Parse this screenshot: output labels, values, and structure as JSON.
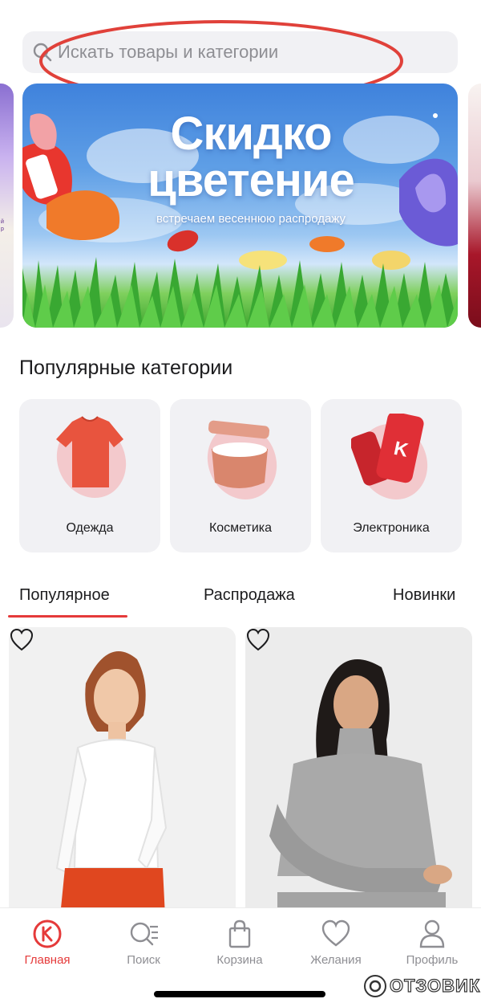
{
  "search": {
    "placeholder": "Искать товары и категории",
    "icon": "search-icon"
  },
  "banner": {
    "title_line1": "Скидко",
    "title_line2": "цветение",
    "subtitle": "встречаем весеннюю распродажу"
  },
  "popular_categories": {
    "title": "Популярные категории",
    "items": [
      {
        "label": "Одежда",
        "icon": "t-shirt-icon"
      },
      {
        "label": "Косметика",
        "icon": "cream-jar-icon"
      },
      {
        "label": "Электроника",
        "icon": "smartphone-icon"
      }
    ]
  },
  "tabs": {
    "items": [
      {
        "label": "Популярное",
        "active": true
      },
      {
        "label": "Распродажа",
        "active": false
      },
      {
        "label": "Новинки",
        "active": false
      }
    ]
  },
  "products": [
    {
      "image": "woman-white-longsleeve",
      "favorite_icon": "heart-icon"
    },
    {
      "image": "woman-grey-turtleneck",
      "favorite_icon": "heart-icon"
    }
  ],
  "bottom_nav": {
    "items": [
      {
        "label": "Главная",
        "icon": "home-logo-icon",
        "active": true
      },
      {
        "label": "Поиск",
        "icon": "search-list-icon",
        "active": false
      },
      {
        "label": "Корзина",
        "icon": "bag-icon",
        "active": false
      },
      {
        "label": "Желания",
        "icon": "heart-icon",
        "active": false
      },
      {
        "label": "Профиль",
        "icon": "profile-icon",
        "active": false
      }
    ]
  },
  "watermark": {
    "text": "ОТЗОВИК"
  },
  "colors": {
    "accent": "#e53a3a",
    "card_background": "#f1f1f4",
    "muted_text": "#8e8e93",
    "annotation": "#e0413a"
  }
}
